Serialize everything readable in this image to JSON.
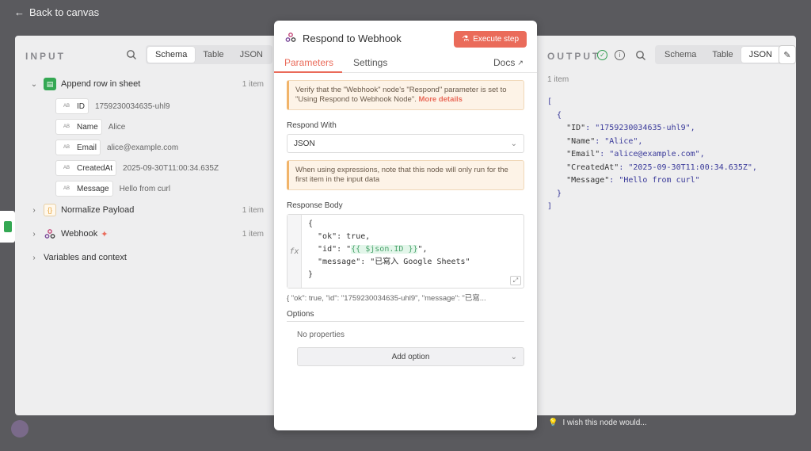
{
  "header": {
    "back_label": "Back to canvas"
  },
  "input": {
    "title": "INPUT",
    "views": [
      "Schema",
      "Table",
      "JSON"
    ],
    "active_view": "Schema",
    "tree": [
      {
        "label": "Append row in sheet",
        "count": "1 item"
      },
      {
        "label": "Normalize Payload",
        "count": "1 item"
      },
      {
        "label": "Webhook",
        "count": "1 item"
      },
      {
        "label": "Variables and context"
      }
    ],
    "fields": [
      {
        "type": "AB",
        "name": "ID",
        "value": "1759230034635-uhl9"
      },
      {
        "type": "AB",
        "name": "Name",
        "value": "Alice"
      },
      {
        "type": "AB",
        "name": "Email",
        "value": "alice@example.com"
      },
      {
        "type": "AB",
        "name": "CreatedAt",
        "value": "2025-09-30T11:00:34.635Z"
      },
      {
        "type": "AB",
        "name": "Message",
        "value": "Hello from curl"
      }
    ]
  },
  "modal": {
    "title": "Respond to Webhook",
    "execute_label": "Execute step",
    "tabs": [
      "Parameters",
      "Settings"
    ],
    "docs_label": "Docs",
    "notice1_text": "Verify that the \"Webhook\" node's \"Respond\" parameter is set to \"Using Respond to Webhook Node\".",
    "notice1_link": "More details",
    "respond_with_label": "Respond With",
    "respond_with_value": "JSON",
    "notice2_text": "When using expressions, note that this node will only run for the first item in the input data",
    "response_body_label": "Response Body",
    "fx_label": "fx",
    "code": {
      "line1": "{",
      "line2": "  \"ok\": true,",
      "line3_pre": "  \"id\": \"",
      "line3_expr": "{{ $json.ID }}",
      "line3_post": "\",",
      "line4": "  \"message\": \"已寫入 Google Sheets\"",
      "line5": "}"
    },
    "preview": "{ \"ok\": true, \"id\": \"1759230034635-uhl9\", \"message\": \"已寫...",
    "options_label": "Options",
    "no_properties": "No properties",
    "add_option_label": "Add option"
  },
  "output": {
    "title": "OUTPUT",
    "views": [
      "Schema",
      "Table",
      "JSON"
    ],
    "active_view": "JSON",
    "item_count": "1 item",
    "json_lines": {
      "open_bracket": "[",
      "open_brace": "  {",
      "id_key": "\"ID\"",
      "id_val": "\"1759230034635-uhl9\"",
      "name_key": "\"Name\"",
      "name_val": "\"Alice\"",
      "email_key": "\"Email\"",
      "email_val": "\"alice@example.com\"",
      "created_key": "\"CreatedAt\"",
      "created_val": "\"2025-09-30T11:00:34.635Z\"",
      "message_key": "\"Message\"",
      "message_val": "\"Hello from curl\"",
      "close_brace": "  }",
      "close_bracket": "]"
    }
  },
  "footer": {
    "hint": "I wish this node would..."
  },
  "colors": {
    "accent": "#ea6b5a",
    "success": "#2e9d4e",
    "sheets_green": "#34a853",
    "panel_bg": "#eeeeef"
  }
}
